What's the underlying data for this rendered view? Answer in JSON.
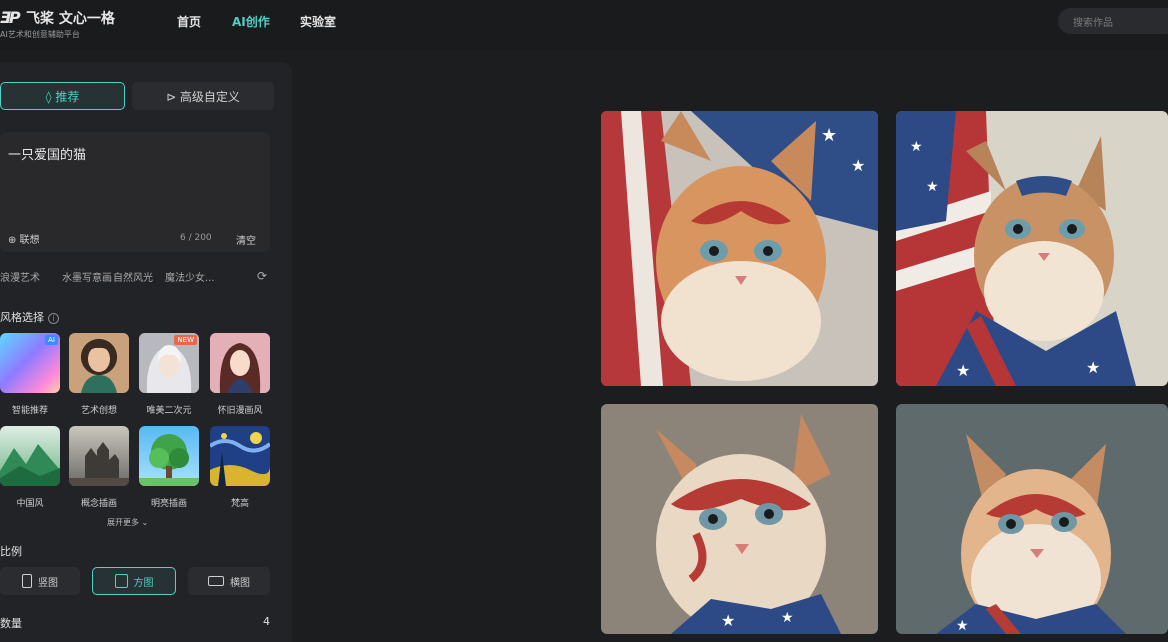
{
  "header": {
    "logo_mark": "ƎP",
    "app_name": "飞桨 文心一格",
    "app_tagline": "AI艺术和创意辅助平台",
    "nav": [
      "首页",
      "AI创作",
      "实验室"
    ],
    "active_nav": "AI创作",
    "search_placeholder": "搜索作品"
  },
  "sidebar": {
    "tabs": [
      {
        "label": "◊ 推荐",
        "active": true
      },
      {
        "label": "⊳ 高级自定义",
        "active": false
      }
    ],
    "prompt": {
      "value": "一只爱国的猫",
      "assoc_label": "⊕ 联想",
      "char_count": "6 / 200",
      "clear_label": "清空"
    },
    "suggestions": [
      "浪漫艺术",
      "水墨写意画",
      "自然风光",
      "魔法少女..."
    ],
    "style_section": {
      "title": "风格选择",
      "styles": [
        {
          "label": "智能推荐",
          "badge": "AI"
        },
        {
          "label": "艺术创想",
          "badge": ""
        },
        {
          "label": "唯美二次元",
          "badge": "NEW"
        },
        {
          "label": "怀旧漫画风",
          "badge": ""
        },
        {
          "label": "中国风",
          "badge": ""
        },
        {
          "label": "概念插画",
          "badge": ""
        },
        {
          "label": "明亮插画",
          "badge": ""
        },
        {
          "label": "梵高",
          "badge": ""
        }
      ],
      "more_label": "展开更多 ⌄"
    },
    "ratio_section": {
      "title": "比例",
      "options": [
        {
          "label": "竖图",
          "active": false
        },
        {
          "label": "方图",
          "active": true
        },
        {
          "label": "横图",
          "active": false
        }
      ]
    },
    "quantity": {
      "label": "数量",
      "value": "4"
    }
  },
  "colors": {
    "accent": "#4fd1c7",
    "background": "#1c1d1f",
    "panel": "#222326"
  },
  "results": {
    "images": [
      "patriotic-cat-1",
      "patriotic-cat-2",
      "patriotic-cat-3",
      "patriotic-cat-4"
    ]
  }
}
